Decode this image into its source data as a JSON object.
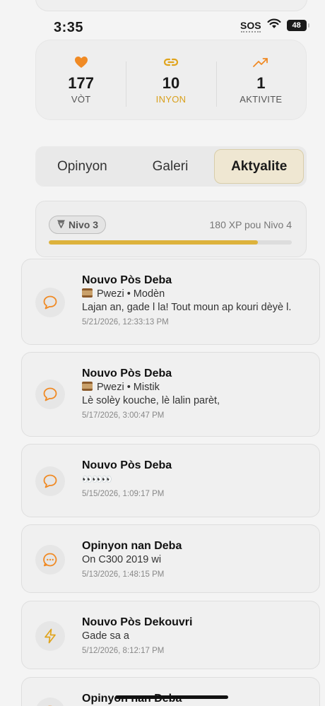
{
  "status_bar": {
    "time": "3:35",
    "sos": "SOS",
    "battery": "48"
  },
  "stats": [
    {
      "name": "votes",
      "icon": "heart-icon",
      "value": "177",
      "label": "VÒT",
      "color": "#f08a24",
      "label_color": "#555555"
    },
    {
      "name": "links",
      "icon": "link-icon",
      "value": "10",
      "label": "INYON",
      "color": "#e0a41c",
      "label_color": "#d9a01c"
    },
    {
      "name": "activity",
      "icon": "trending-up-icon",
      "value": "1",
      "label": "AKTIVITE",
      "color": "#f08a24",
      "label_color": "#555555"
    }
  ],
  "tabs": [
    {
      "label": "Opinyon",
      "active": false
    },
    {
      "label": "Galeri",
      "active": false
    },
    {
      "label": "Aktyalite",
      "active": true
    }
  ],
  "level": {
    "badge": "Nivo 3",
    "next": "180 XP pou Nivo 4",
    "progress_fraction": 0.86,
    "bar_color": "#ddb23c"
  },
  "feed": [
    {
      "icon": "chat-bubble-icon",
      "title": "Nouvo Pòs Deba",
      "has_scroll": true,
      "line1": "Pwezi • Modèn",
      "line2": "Lajan an, gade l la! Tout moun ap kouri dèyè l.",
      "time": "5/21/2026, 12:33:13 PM"
    },
    {
      "icon": "chat-bubble-icon",
      "title": "Nouvo Pòs Deba",
      "has_scroll": true,
      "line1": "Pwezi • Mistik",
      "line2": "Lè solèy kouche, lè lalin parèt,",
      "time": "5/17/2026, 3:00:47 PM"
    },
    {
      "icon": "chat-bubble-icon",
      "title": "Nouvo Pòs Deba",
      "has_scroll": false,
      "line1": "👀👀👀",
      "line2": "",
      "time": "5/15/2026, 1:09:17 PM"
    },
    {
      "icon": "chat-dots-icon",
      "title": "Opinyon nan Deba",
      "has_scroll": false,
      "line1": "On C300 2019 wi",
      "line2": "",
      "time": "5/13/2026, 1:48:15 PM"
    },
    {
      "icon": "lightning-icon",
      "title": "Nouvo Pòs Dekouvri",
      "has_scroll": false,
      "line1": "Gade sa a",
      "line2": "",
      "time": "5/12/2026, 8:12:17 PM"
    },
    {
      "icon": "chat-dots-icon",
      "title": "Opinyon nan Deba",
      "has_scroll": false,
      "line1": "",
      "line2": "",
      "time": ""
    }
  ],
  "colors": {
    "accent_orange": "#f08a24",
    "accent_gold": "#ddb23c"
  }
}
